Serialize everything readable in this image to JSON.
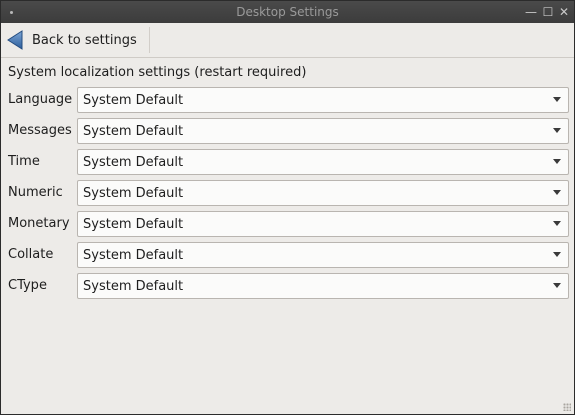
{
  "window": {
    "title": "Desktop Settings"
  },
  "titlebar_buttons": {
    "minimize": "—",
    "maximize": "☐",
    "close": "✕"
  },
  "toolbar": {
    "back_label": "Back to settings"
  },
  "section": {
    "title": "System localization settings (restart required)"
  },
  "rows": [
    {
      "label": "Language",
      "value": "System Default"
    },
    {
      "label": "Messages",
      "value": "System Default"
    },
    {
      "label": "Time",
      "value": "System Default"
    },
    {
      "label": "Numeric",
      "value": "System Default"
    },
    {
      "label": "Monetary",
      "value": "System Default"
    },
    {
      "label": "Collate",
      "value": "System Default"
    },
    {
      "label": "CType",
      "value": "System Default"
    }
  ],
  "colors": {
    "window_bg": "#edebe8",
    "titlebar_bg": "#3c3c3c",
    "back_icon": "#2c5d9b"
  },
  "icons": {
    "back": "back-arrow-icon",
    "dropdown": "chevron-down-icon",
    "resize": "resize-grip-icon"
  }
}
